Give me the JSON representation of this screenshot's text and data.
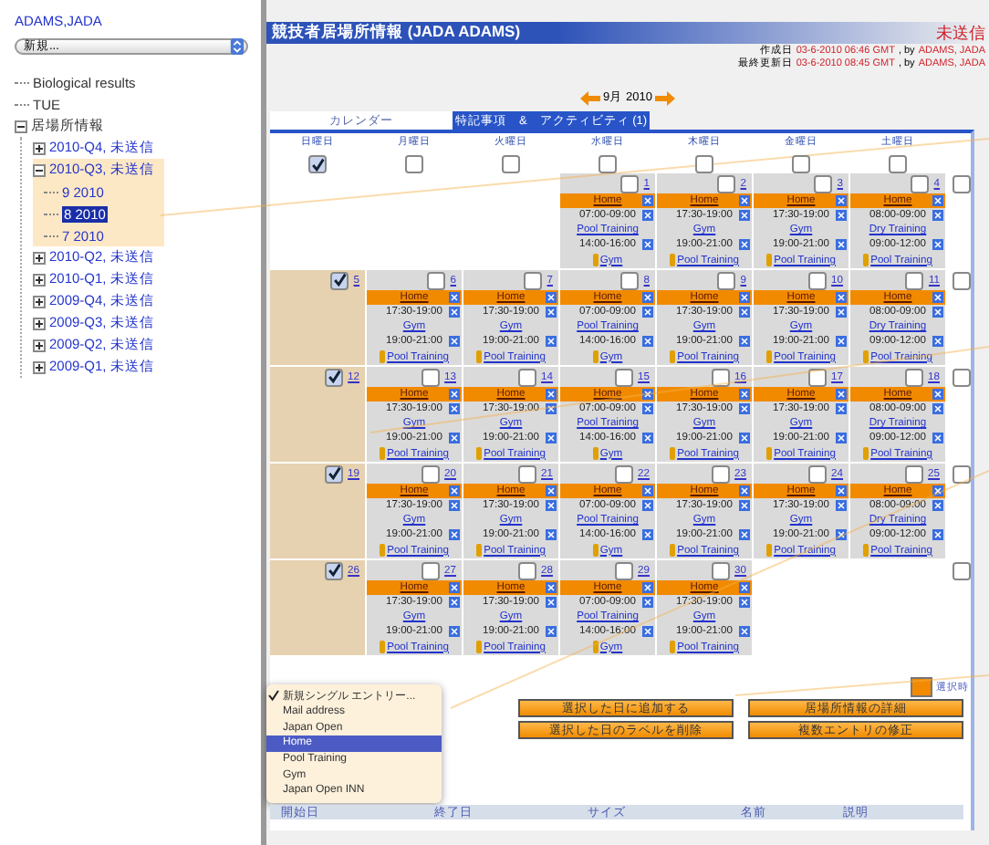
{
  "sidebar": {
    "user": "ADAMS,JADA",
    "select": "新規...",
    "items": [
      {
        "label": "Biological results"
      },
      {
        "label": "TUE"
      },
      {
        "label": "居場所情報",
        "expanded": true,
        "children": [
          {
            "label": "2010-Q4, 未送信",
            "expanded": false,
            "highlighted": false
          },
          {
            "label": "2010-Q3, 未送信",
            "expanded": true,
            "highlighted": true,
            "children": [
              {
                "label": "9 2010",
                "selected": false
              },
              {
                "label": "8 2010",
                "selected": true
              },
              {
                "label": "7 2010",
                "selected": false
              }
            ]
          },
          {
            "label": "2010-Q2, 未送信",
            "expanded": false,
            "highlighted": false
          },
          {
            "label": "2010-Q1, 未送信",
            "expanded": false,
            "highlighted": false
          },
          {
            "label": "2009-Q4, 未送信",
            "expanded": false,
            "highlighted": false
          },
          {
            "label": "2009-Q3, 未送信",
            "expanded": false,
            "highlighted": false
          },
          {
            "label": "2009-Q2, 未送信",
            "expanded": false,
            "highlighted": false
          },
          {
            "label": "2009-Q1, 未送信",
            "expanded": false,
            "highlighted": false
          }
        ]
      }
    ]
  },
  "header": {
    "title": "競技者居場所情報 (JADA ADAMS)",
    "status": "未送信",
    "meta": [
      {
        "label": "作成日",
        "date": "03-6-2010 06:46 GMT",
        "by": ", by",
        "author": "ADAMS, JADA"
      },
      {
        "label": "最終更新日",
        "date": "03-6-2010 08:45 GMT",
        "by": ", by",
        "author": "ADAMS, JADA"
      }
    ]
  },
  "month": "9月 2010",
  "tabs": [
    {
      "label": "カレンダー",
      "selected": true
    },
    {
      "label": "特記事項　&　アクティビティ (1)",
      "selected": false
    }
  ],
  "weekdays": [
    {
      "label": "日曜日",
      "checked": true
    },
    {
      "label": "月曜日",
      "checked": false
    },
    {
      "label": "火曜日",
      "checked": false
    },
    {
      "label": "水曜日",
      "checked": false
    },
    {
      "label": "木曜日",
      "checked": false
    },
    {
      "label": "金曜日",
      "checked": false
    },
    {
      "label": "土曜日",
      "checked": false
    }
  ],
  "weeks": [
    {
      "checked": false,
      "days": [
        {
          "kind": "empty"
        },
        {
          "kind": "empty"
        },
        {
          "kind": "empty"
        },
        {
          "kind": "day",
          "day": "1",
          "checked": false,
          "location": "Home",
          "entries": [
            {
              "time": "07:00-09:00",
              "activity": "Pool Training",
              "flag": false
            },
            {
              "time": "14:00-16:00",
              "activity": "Gym",
              "flag": true
            }
          ]
        },
        {
          "kind": "day",
          "day": "2",
          "checked": false,
          "location": "Home",
          "entries": [
            {
              "time": "17:30-19:00",
              "activity": "Gym",
              "flag": false
            },
            {
              "time": "19:00-21:00",
              "activity": "Pool Training",
              "flag": true
            }
          ]
        },
        {
          "kind": "day",
          "day": "3",
          "checked": false,
          "location": "Home",
          "entries": [
            {
              "time": "17:30-19:00",
              "activity": "Gym",
              "flag": false
            },
            {
              "time": "19:00-21:00",
              "activity": "Pool Training",
              "flag": true
            }
          ]
        },
        {
          "kind": "day",
          "day": "4",
          "checked": false,
          "location": "Home",
          "entries": [
            {
              "time": "08:00-09:00",
              "activity": "Dry Training",
              "flag": false
            },
            {
              "time": "09:00-12:00",
              "activity": "Pool Training",
              "flag": true
            }
          ]
        }
      ]
    },
    {
      "checked": false,
      "days": [
        {
          "kind": "sunday",
          "day": "5",
          "checked": true
        },
        {
          "kind": "day",
          "day": "6",
          "checked": false,
          "location": "Home",
          "entries": [
            {
              "time": "17:30-19:00",
              "activity": "Gym",
              "flag": false
            },
            {
              "time": "19:00-21:00",
              "activity": "Pool Training",
              "flag": true
            }
          ]
        },
        {
          "kind": "day",
          "day": "7",
          "checked": false,
          "location": "Home",
          "entries": [
            {
              "time": "17:30-19:00",
              "activity": "Gym",
              "flag": false
            },
            {
              "time": "19:00-21:00",
              "activity": "Pool Training",
              "flag": true
            }
          ]
        },
        {
          "kind": "day",
          "day": "8",
          "checked": false,
          "location": "Home",
          "entries": [
            {
              "time": "07:00-09:00",
              "activity": "Pool Training",
              "flag": false
            },
            {
              "time": "14:00-16:00",
              "activity": "Gym",
              "flag": true
            }
          ]
        },
        {
          "kind": "day",
          "day": "9",
          "checked": false,
          "location": "Home",
          "entries": [
            {
              "time": "17:30-19:00",
              "activity": "Gym",
              "flag": false
            },
            {
              "time": "19:00-21:00",
              "activity": "Pool Training",
              "flag": true
            }
          ]
        },
        {
          "kind": "day",
          "day": "10",
          "checked": false,
          "location": "Home",
          "entries": [
            {
              "time": "17:30-19:00",
              "activity": "Gym",
              "flag": false
            },
            {
              "time": "19:00-21:00",
              "activity": "Pool Training",
              "flag": true
            }
          ]
        },
        {
          "kind": "day",
          "day": "11",
          "checked": false,
          "location": "Home",
          "entries": [
            {
              "time": "08:00-09:00",
              "activity": "Dry Training",
              "flag": false
            },
            {
              "time": "09:00-12:00",
              "activity": "Pool Training",
              "flag": true
            }
          ]
        }
      ]
    },
    {
      "checked": false,
      "days": [
        {
          "kind": "sunday",
          "day": "12",
          "checked": true
        },
        {
          "kind": "day",
          "day": "13",
          "checked": false,
          "location": "Home",
          "entries": [
            {
              "time": "17:30-19:00",
              "activity": "Gym",
              "flag": false
            },
            {
              "time": "19:00-21:00",
              "activity": "Pool Training",
              "flag": true
            }
          ]
        },
        {
          "kind": "day",
          "day": "14",
          "checked": false,
          "location": "Home",
          "entries": [
            {
              "time": "17:30-19:00",
              "activity": "Gym",
              "flag": false
            },
            {
              "time": "19:00-21:00",
              "activity": "Pool Training",
              "flag": true
            }
          ]
        },
        {
          "kind": "day",
          "day": "15",
          "checked": false,
          "location": "Home",
          "entries": [
            {
              "time": "07:00-09:00",
              "activity": "Pool Training",
              "flag": false
            },
            {
              "time": "14:00-16:00",
              "activity": "Gym",
              "flag": true
            }
          ]
        },
        {
          "kind": "day",
          "day": "16",
          "checked": false,
          "location": "Home",
          "entries": [
            {
              "time": "17:30-19:00",
              "activity": "Gym",
              "flag": false
            },
            {
              "time": "19:00-21:00",
              "activity": "Pool Training",
              "flag": true
            }
          ]
        },
        {
          "kind": "day",
          "day": "17",
          "checked": false,
          "location": "Home",
          "entries": [
            {
              "time": "17:30-19:00",
              "activity": "Gym",
              "flag": false
            },
            {
              "time": "19:00-21:00",
              "activity": "Pool Training",
              "flag": true
            }
          ]
        },
        {
          "kind": "day",
          "day": "18",
          "checked": false,
          "location": "Home",
          "entries": [
            {
              "time": "08:00-09:00",
              "activity": "Dry Training",
              "flag": false
            },
            {
              "time": "09:00-12:00",
              "activity": "Pool Training",
              "flag": true
            }
          ]
        }
      ]
    },
    {
      "checked": false,
      "days": [
        {
          "kind": "sunday",
          "day": "19",
          "checked": true
        },
        {
          "kind": "day",
          "day": "20",
          "checked": false,
          "location": "Home",
          "entries": [
            {
              "time": "17:30-19:00",
              "activity": "Gym",
              "flag": false
            },
            {
              "time": "19:00-21:00",
              "activity": "Pool Training",
              "flag": true
            }
          ]
        },
        {
          "kind": "day",
          "day": "21",
          "checked": false,
          "location": "Home",
          "entries": [
            {
              "time": "17:30-19:00",
              "activity": "Gym",
              "flag": false
            },
            {
              "time": "19:00-21:00",
              "activity": "Pool Training",
              "flag": true
            }
          ]
        },
        {
          "kind": "day",
          "day": "22",
          "checked": false,
          "location": "Home",
          "entries": [
            {
              "time": "07:00-09:00",
              "activity": "Pool Training",
              "flag": false
            },
            {
              "time": "14:00-16:00",
              "activity": "Gym",
              "flag": true
            }
          ]
        },
        {
          "kind": "day",
          "day": "23",
          "checked": false,
          "location": "Home",
          "entries": [
            {
              "time": "17:30-19:00",
              "activity": "Gym",
              "flag": false
            },
            {
              "time": "19:00-21:00",
              "activity": "Pool Training",
              "flag": true
            }
          ]
        },
        {
          "kind": "day",
          "day": "24",
          "checked": false,
          "location": "Home",
          "entries": [
            {
              "time": "17:30-19:00",
              "activity": "Gym",
              "flag": false
            },
            {
              "time": "19:00-21:00",
              "activity": "Pool Training",
              "flag": true
            }
          ]
        },
        {
          "kind": "day",
          "day": "25",
          "checked": false,
          "location": "Home",
          "entries": [
            {
              "time": "08:00-09:00",
              "activity": "Dry Training",
              "flag": false
            },
            {
              "time": "09:00-12:00",
              "activity": "Pool Training",
              "flag": true
            }
          ]
        }
      ]
    },
    {
      "checked": false,
      "days": [
        {
          "kind": "sunday",
          "day": "26",
          "checked": true
        },
        {
          "kind": "day",
          "day": "27",
          "checked": false,
          "location": "Home",
          "entries": [
            {
              "time": "17:30-19:00",
              "activity": "Gym",
              "flag": false
            },
            {
              "time": "19:00-21:00",
              "activity": "Pool Training",
              "flag": true
            }
          ]
        },
        {
          "kind": "day",
          "day": "28",
          "checked": false,
          "location": "Home",
          "entries": [
            {
              "time": "17:30-19:00",
              "activity": "Gym",
              "flag": false
            },
            {
              "time": "19:00-21:00",
              "activity": "Pool Training",
              "flag": true
            }
          ]
        },
        {
          "kind": "day",
          "day": "29",
          "checked": false,
          "location": "Home",
          "entries": [
            {
              "time": "07:00-09:00",
              "activity": "Pool Training",
              "flag": false
            },
            {
              "time": "14:00-16:00",
              "activity": "Gym",
              "flag": true
            }
          ]
        },
        {
          "kind": "day",
          "day": "30",
          "checked": false,
          "location": "Home",
          "entries": [
            {
              "time": "17:30-19:00",
              "activity": "Gym",
              "flag": false
            },
            {
              "time": "19:00-21:00",
              "activity": "Pool Training",
              "flag": true
            }
          ]
        },
        {
          "kind": "empty"
        },
        {
          "kind": "empty"
        }
      ]
    }
  ],
  "menu": [
    {
      "label": "新規シングル エントリー...",
      "checked": true,
      "selected": false
    },
    {
      "label": "Mail address",
      "checked": false,
      "selected": false
    },
    {
      "label": "Japan Open",
      "checked": false,
      "selected": false
    },
    {
      "label": "Home",
      "checked": false,
      "selected": true
    },
    {
      "label": "Pool Training",
      "checked": false,
      "selected": false
    },
    {
      "label": "Gym",
      "checked": false,
      "selected": false
    },
    {
      "label": "Japan Open INN",
      "checked": false,
      "selected": false
    }
  ],
  "legend": {
    "label": "選択時"
  },
  "buttons": [
    "選択した日に追加する",
    "居場所情報の詳細",
    "選択した日のラベルを削除",
    "複数エントリの修正"
  ],
  "table": {
    "columns": [
      "開始日",
      "終了日",
      "サイズ",
      "名前",
      "説明"
    ]
  }
}
